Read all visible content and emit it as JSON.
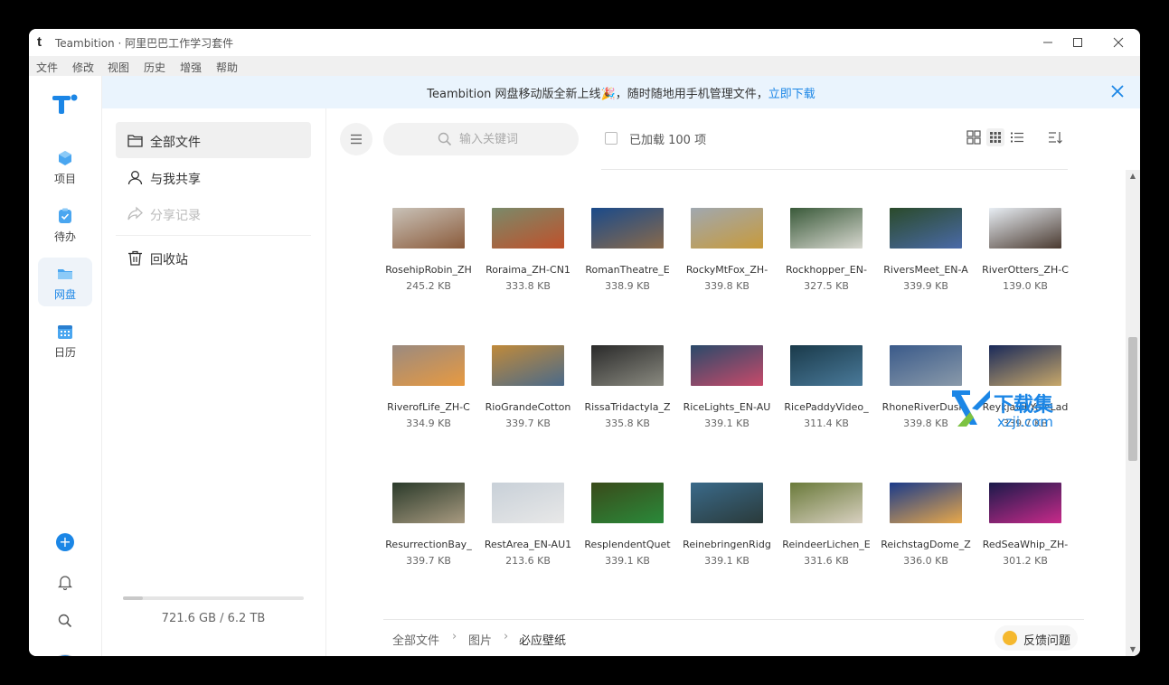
{
  "window": {
    "title": "Teambition · 阿里巴巴工作学习套件",
    "controls": [
      "minimize-icon",
      "maximize-icon",
      "close-icon"
    ]
  },
  "menubar": {
    "items": [
      "文件",
      "修改",
      "视图",
      "历史",
      "增强",
      "帮助"
    ]
  },
  "banner": {
    "text": "Teambition 网盘移动版全新上线🎉，随时随地用手机管理文件，",
    "link": "立即下载"
  },
  "rail": {
    "items": [
      {
        "label": "项目",
        "icon": "project-icon",
        "color": "#4aa6f0"
      },
      {
        "label": "待办",
        "icon": "todo-icon",
        "color": "#4aa6f0"
      },
      {
        "label": "网盘",
        "icon": "drive-icon",
        "color": "#4aa6f0",
        "active": true
      },
      {
        "label": "日历",
        "icon": "calendar-icon",
        "color": "#4aa6f0"
      }
    ],
    "add_label": "+"
  },
  "sidebar": {
    "items": [
      {
        "label": "全部文件",
        "icon": "folder-icon",
        "active": true
      },
      {
        "label": "与我共享",
        "icon": "user-icon"
      },
      {
        "label": "分享记录",
        "icon": "share-icon",
        "disabled": true
      },
      {
        "label": "回收站",
        "icon": "trash-icon"
      }
    ],
    "storage": {
      "used": "721.6 GB",
      "total": "6.2 TB",
      "text": "721.6 GB / 6.2 TB",
      "fraction": 0.11
    }
  },
  "toolbar": {
    "search_placeholder": "输入关键词",
    "loaded_text": "已加载 100 项"
  },
  "files": [
    {
      "name": "RosehipRobin_ZH",
      "size": "245.2 KB",
      "colors": [
        "#c9c2b8",
        "#8a5a3a"
      ]
    },
    {
      "name": "Roraima_ZH-CN1",
      "size": "333.8 KB",
      "colors": [
        "#7a8a6a",
        "#c0502a"
      ]
    },
    {
      "name": "RomanTheatre_E",
      "size": "338.9 KB",
      "colors": [
        "#1a4a8a",
        "#8a6a4a"
      ]
    },
    {
      "name": "RockyMtFox_ZH-",
      "size": "339.8 KB",
      "colors": [
        "#a0a8b0",
        "#c89a3a"
      ]
    },
    {
      "name": "Rockhopper_EN-",
      "size": "327.5 KB",
      "colors": [
        "#3a5a3a",
        "#d8d8d0"
      ]
    },
    {
      "name": "RiversMeet_EN-A",
      "size": "339.9 KB",
      "colors": [
        "#2a4a2a",
        "#4a6aa8"
      ]
    },
    {
      "name": "RiverOtters_ZH-C",
      "size": "139.0 KB",
      "colors": [
        "#e8eef4",
        "#4a3a30"
      ]
    },
    {
      "name": "RiverofLife_ZH-C",
      "size": "334.9 KB",
      "colors": [
        "#9a8a80",
        "#e89a40"
      ]
    },
    {
      "name": "RioGrandeCotton",
      "size": "339.7 KB",
      "colors": [
        "#c08a3a",
        "#4a6a8a"
      ]
    },
    {
      "name": "RissaTridactyla_Z",
      "size": "335.8 KB",
      "colors": [
        "#2a2a2a",
        "#8a8a80"
      ]
    },
    {
      "name": "RiceLights_EN-AU",
      "size": "339.1 KB",
      "colors": [
        "#2a4a6a",
        "#c84a6a"
      ]
    },
    {
      "name": "RicePaddyVideo_",
      "size": "311.4 KB",
      "colors": [
        "#1a3a4a",
        "#4a7a9a"
      ]
    },
    {
      "name": "RhoneRiverDusk_",
      "size": "339.8 KB",
      "colors": [
        "#3a5a8a",
        "#8a9aaa"
      ]
    },
    {
      "name": "ReykjavikYuleLad",
      "size": "339.7 KB",
      "colors": [
        "#1a2a5a",
        "#c8a86a"
      ]
    },
    {
      "name": "ResurrectionBay_",
      "size": "339.7 KB",
      "colors": [
        "#2a3a2a",
        "#a89a80"
      ]
    },
    {
      "name": "RestArea_EN-AU1",
      "size": "213.6 KB",
      "colors": [
        "#c8d0d8",
        "#e8e8e8"
      ]
    },
    {
      "name": "ResplendentQuet",
      "size": "339.1 KB",
      "colors": [
        "#3a4a1a",
        "#2a8a3a"
      ]
    },
    {
      "name": "ReinebringenRidg",
      "size": "339.1 KB",
      "colors": [
        "#3a6a8a",
        "#2a3a3a"
      ]
    },
    {
      "name": "ReindeerLichen_E",
      "size": "331.6 KB",
      "colors": [
        "#6a7a3a",
        "#d8d0c0"
      ]
    },
    {
      "name": "ReichstagDome_Z",
      "size": "336.0 KB",
      "colors": [
        "#1a3a8a",
        "#e8a84a"
      ]
    },
    {
      "name": "RedSeaWhip_ZH-",
      "size": "301.2 KB",
      "colors": [
        "#1a1a4a",
        "#c82a8a"
      ]
    }
  ],
  "breadcrumb": [
    "全部文件",
    "图片",
    "必应壁纸"
  ],
  "feedback_label": "反馈问题",
  "watermark": {
    "text": "下载集",
    "domain": "xzji.com"
  },
  "accent": "#1b86e6"
}
